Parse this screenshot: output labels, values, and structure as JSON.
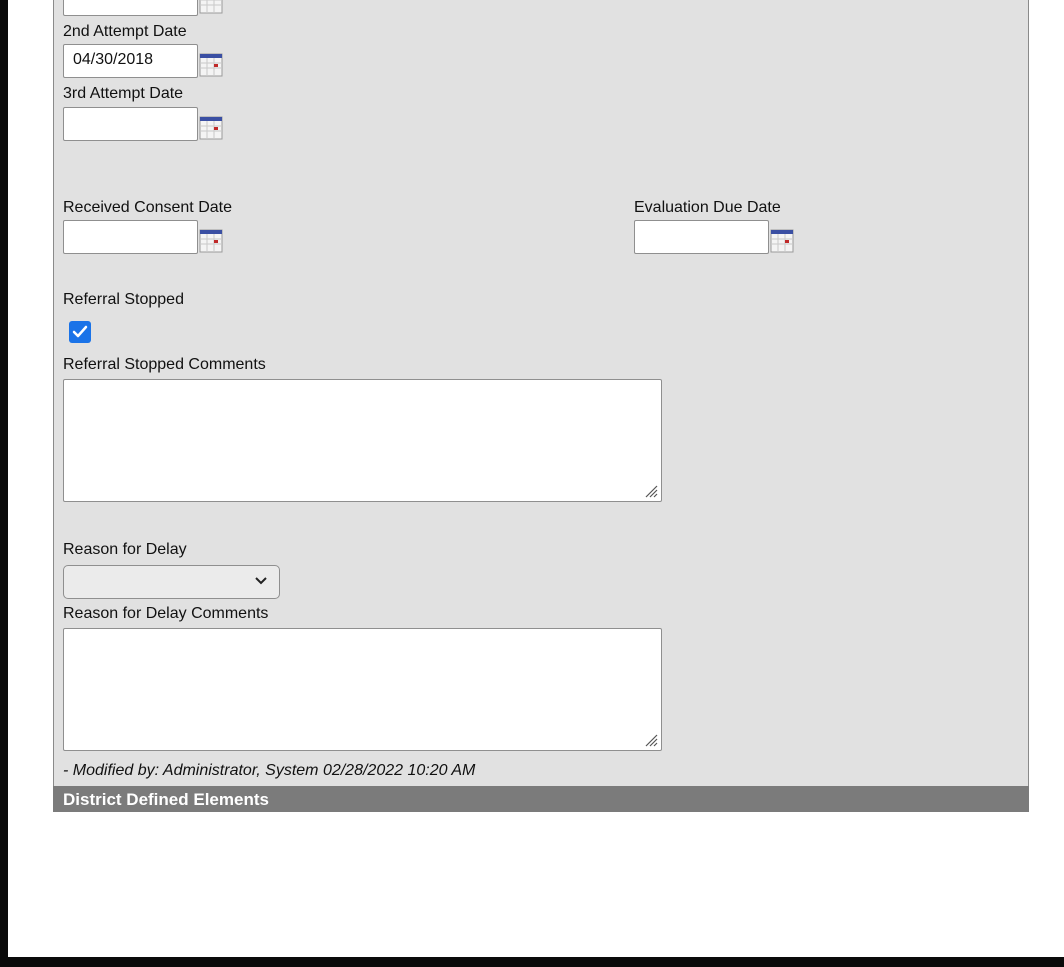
{
  "form": {
    "first_attempt": {
      "value": ""
    },
    "second_attempt": {
      "label": "2nd Attempt Date",
      "value": "04/30/2018"
    },
    "third_attempt": {
      "label": "3rd Attempt Date",
      "value": ""
    },
    "received_consent": {
      "label": "Received Consent Date",
      "value": ""
    },
    "evaluation_due": {
      "label": "Evaluation Due Date",
      "value": ""
    },
    "referral_stopped": {
      "label": "Referral Stopped",
      "checked": true
    },
    "referral_stopped_comments": {
      "label": "Referral Stopped Comments",
      "value": ""
    },
    "reason_for_delay": {
      "label": "Reason for Delay",
      "selected": ""
    },
    "reason_for_delay_comments": {
      "label": "Reason for Delay Comments",
      "value": ""
    },
    "modified_by": "- Modified by: Administrator, System 02/28/2022 10:20 AM"
  },
  "section": {
    "title": "District Defined Elements"
  },
  "icons": {
    "calendar": "calendar-icon",
    "check": "check-icon",
    "resize": "resize-grip-icon",
    "dropdown": "chevron-down-icon"
  },
  "colors": {
    "panel_bg": "#e1e1e1",
    "section_bar": "#7b7b7b",
    "checkbox_accent": "#1a73e8"
  }
}
